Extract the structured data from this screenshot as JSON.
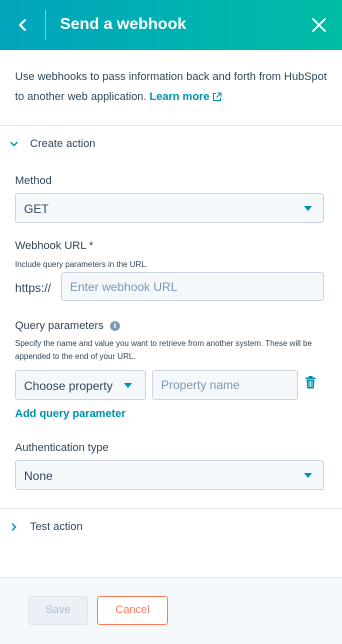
{
  "header": {
    "title": "Send a webhook",
    "back_icon": "chevron-left-icon",
    "close_icon": "close-icon"
  },
  "intro": {
    "text": "Use webhooks to pass information back and forth from HubSpot to another web application.",
    "link_label": "Learn more",
    "link_icon": "external-link-icon"
  },
  "create_action": {
    "label": "Create action",
    "expanded": true
  },
  "method": {
    "label": "Method",
    "value": "GET"
  },
  "webhook_url": {
    "label": "Webhook URL *",
    "help": "Include query parameters in the URL.",
    "prefix": "https://",
    "placeholder": "Enter webhook URL",
    "value": ""
  },
  "query_parameters": {
    "label": "Query parameters",
    "help": "Specify the name and value you want to retrieve from another system. These will be appended to the end of your URL.",
    "property_select": "Choose property",
    "name_placeholder": "Property name",
    "add_label": "Add query parameter"
  },
  "authentication": {
    "label": "Authentication type",
    "value": "None"
  },
  "test_action": {
    "label": "Test action",
    "expanded": false
  },
  "footer": {
    "save_label": "Save",
    "cancel_label": "Cancel"
  },
  "colors": {
    "header_gradient_start": "#00a4bd",
    "header_gradient_end": "#00bda5",
    "link": "#0091ae",
    "cancel": "#ff7a59",
    "text": "#33475b"
  }
}
